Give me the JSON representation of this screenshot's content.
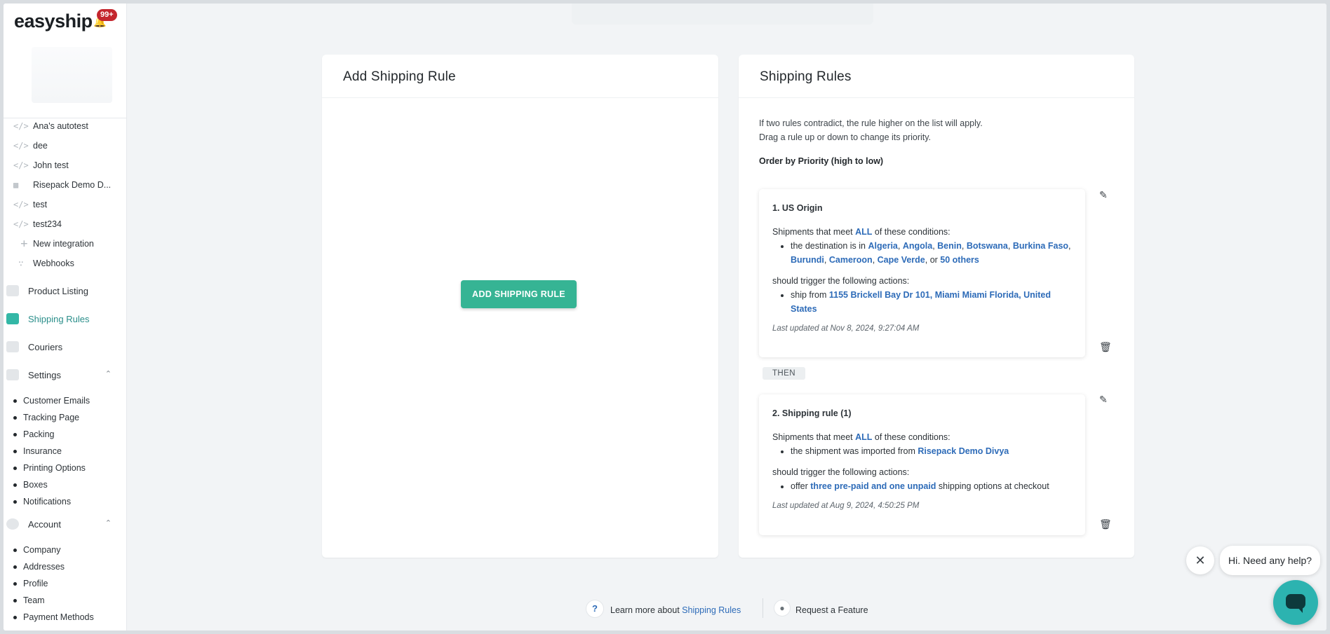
{
  "brand": {
    "logo_text": "easyship",
    "notifications_badge": "99+"
  },
  "sidebar": {
    "integrations": [
      {
        "label": "Ana's autotest",
        "icon": "code-icon"
      },
      {
        "label": "dee",
        "icon": "code-icon"
      },
      {
        "label": "John test",
        "icon": "code-icon"
      },
      {
        "label": "Risepack Demo D...",
        "icon": "shopping-bag-icon"
      },
      {
        "label": "test",
        "icon": "code-icon"
      },
      {
        "label": "test234",
        "icon": "code-icon"
      },
      {
        "label": "New integration",
        "icon": "plus-icon"
      },
      {
        "label": "Webhooks",
        "icon": "webhook-icon"
      }
    ],
    "nav": {
      "product_listing": "Product Listing",
      "shipping_rules": "Shipping Rules",
      "couriers": "Couriers",
      "settings": "Settings",
      "account": "Account"
    },
    "settings_items": [
      "Customer Emails",
      "Tracking Page",
      "Packing",
      "Insurance",
      "Printing Options",
      "Boxes",
      "Notifications"
    ],
    "account_items": [
      "Company",
      "Addresses",
      "Profile",
      "Team",
      "Payment Methods"
    ]
  },
  "add_panel": {
    "title": "Add Shipping Rule",
    "button_label": "ADD SHIPPING RULE"
  },
  "rules_panel": {
    "title": "Shipping Rules",
    "intro_line1": "If two rules contradict, the rule higher on the list will apply.",
    "intro_line2": "Drag a rule up or down to change its priority.",
    "order_label": "Order by Priority (high to low)",
    "then_label": "THEN",
    "rule1": {
      "title": "1. US Origin",
      "cond_prefix": "Shipments that meet ",
      "cond_all": "ALL",
      "cond_suffix": " of these conditions:",
      "dest_prefix": "the destination is in ",
      "countries": [
        "Algeria",
        "Angola",
        "Benin",
        "Botswana",
        "Burkina Faso",
        "Burundi",
        "Cameroon",
        "Cape Verde"
      ],
      "or_text": ", or ",
      "others": "50 others",
      "actions_label": "should trigger the following actions:",
      "ship_prefix": "ship from ",
      "ship_address": "1155 Brickell Bay Dr 101, Miami Miami Florida, United States",
      "updated": "Last updated at Nov 8, 2024, 9:27:04 AM"
    },
    "rule2": {
      "title": "2. Shipping rule (1)",
      "cond_prefix": "Shipments that meet ",
      "cond_all": "ALL",
      "cond_suffix": " of these conditions:",
      "imported_prefix": "the shipment was imported from ",
      "imported_store": "Risepack Demo Divya",
      "actions_label": "should trigger the following actions:",
      "offer_prefix": "offer ",
      "offer_value": "three pre-paid and one unpaid",
      "offer_suffix": " shipping options at checkout",
      "updated": "Last updated at Aug 9, 2024, 4:50:25 PM"
    }
  },
  "footer": {
    "learn_prefix": "Learn more about ",
    "learn_link": "Shipping Rules",
    "request_feature": "Request a Feature"
  },
  "chat": {
    "greeting": "Hi. Need any help?"
  },
  "colors": {
    "accent": "#36b494",
    "link": "#2d6bb8",
    "active_nav": "#2a8e8a",
    "badge": "#c4262e",
    "chat": "#2cb3b0"
  }
}
